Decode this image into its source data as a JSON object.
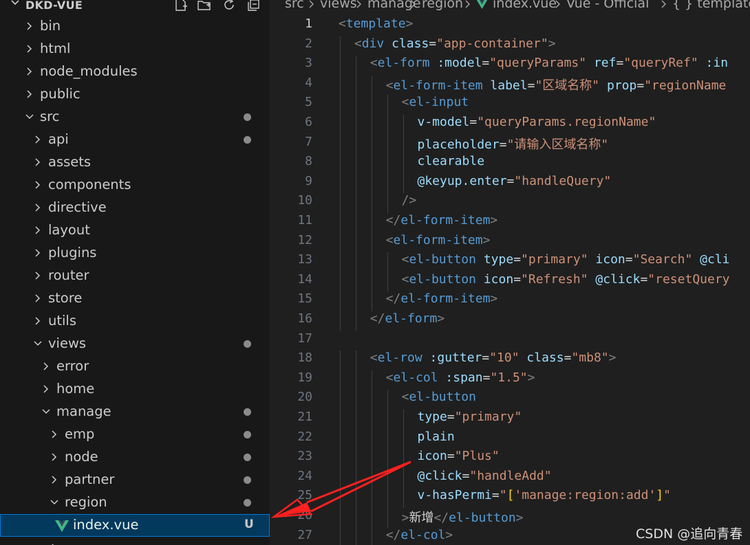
{
  "explorer": {
    "project": "DKD-VUE",
    "tree": [
      {
        "label": "bin",
        "level": 0,
        "expanded": false,
        "dot": false
      },
      {
        "label": "html",
        "level": 0,
        "expanded": false,
        "dot": false
      },
      {
        "label": "node_modules",
        "level": 0,
        "expanded": false,
        "dot": false
      },
      {
        "label": "public",
        "level": 0,
        "expanded": false,
        "dot": false
      },
      {
        "label": "src",
        "level": 0,
        "expanded": true,
        "dot": true
      },
      {
        "label": "api",
        "level": 1,
        "expanded": false,
        "dot": true
      },
      {
        "label": "assets",
        "level": 1,
        "expanded": false,
        "dot": false
      },
      {
        "label": "components",
        "level": 1,
        "expanded": false,
        "dot": false
      },
      {
        "label": "directive",
        "level": 1,
        "expanded": false,
        "dot": false
      },
      {
        "label": "layout",
        "level": 1,
        "expanded": false,
        "dot": false
      },
      {
        "label": "plugins",
        "level": 1,
        "expanded": false,
        "dot": false
      },
      {
        "label": "router",
        "level": 1,
        "expanded": false,
        "dot": false
      },
      {
        "label": "store",
        "level": 1,
        "expanded": false,
        "dot": false
      },
      {
        "label": "utils",
        "level": 1,
        "expanded": false,
        "dot": false
      },
      {
        "label": "views",
        "level": 1,
        "expanded": true,
        "dot": true
      },
      {
        "label": "error",
        "level": 2,
        "expanded": false,
        "dot": false
      },
      {
        "label": "home",
        "level": 2,
        "expanded": false,
        "dot": false
      },
      {
        "label": "manage",
        "level": 2,
        "expanded": true,
        "dot": true
      },
      {
        "label": "emp",
        "level": 3,
        "expanded": false,
        "dot": true
      },
      {
        "label": "node",
        "level": 3,
        "expanded": false,
        "dot": true
      },
      {
        "label": "partner",
        "level": 3,
        "expanded": false,
        "dot": true
      },
      {
        "label": "region",
        "level": 3,
        "expanded": true,
        "dot": true
      },
      {
        "label": "index.vue",
        "level": 4,
        "file": true,
        "badge": "U",
        "selected": true
      }
    ]
  },
  "breadcrumb": [
    "src",
    "views",
    "manage",
    "region",
    "index.vue",
    "Vue - Official",
    "{ } template"
  ],
  "editor": {
    "active_line": 1,
    "lines": [
      {
        "n": "1",
        "indent": 0,
        "tokens": [
          [
            "p",
            "<"
          ],
          [
            "t",
            "template"
          ],
          [
            "p",
            ">"
          ]
        ]
      },
      {
        "n": "2",
        "indent": 1,
        "tokens": [
          [
            "p",
            "<"
          ],
          [
            "t",
            "div"
          ],
          [
            "w",
            " "
          ],
          [
            "a",
            "class"
          ],
          [
            "o",
            "="
          ],
          [
            "s",
            "\"app-container\""
          ],
          [
            "p",
            ">"
          ]
        ]
      },
      {
        "n": "3",
        "indent": 2,
        "tokens": [
          [
            "p",
            "<"
          ],
          [
            "t",
            "el-form"
          ],
          [
            "w",
            " "
          ],
          [
            "a",
            ":model"
          ],
          [
            "o",
            "="
          ],
          [
            "s",
            "\"queryParams\""
          ],
          [
            "w",
            " "
          ],
          [
            "a",
            "ref"
          ],
          [
            "o",
            "="
          ],
          [
            "s",
            "\"queryRef\""
          ],
          [
            "w",
            " "
          ],
          [
            "a",
            ":in"
          ]
        ]
      },
      {
        "n": "4",
        "indent": 3,
        "tokens": [
          [
            "p",
            "<"
          ],
          [
            "t",
            "el-form-item"
          ],
          [
            "w",
            " "
          ],
          [
            "a",
            "label"
          ],
          [
            "o",
            "="
          ],
          [
            "s",
            "\"区域名称\""
          ],
          [
            "w",
            " "
          ],
          [
            "a",
            "prop"
          ],
          [
            "o",
            "="
          ],
          [
            "s",
            "\"regionName"
          ]
        ]
      },
      {
        "n": "5",
        "indent": 4,
        "tokens": [
          [
            "p",
            "<"
          ],
          [
            "t",
            "el-input"
          ]
        ]
      },
      {
        "n": "6",
        "indent": 5,
        "tokens": [
          [
            "a",
            "v-model"
          ],
          [
            "o",
            "="
          ],
          [
            "s",
            "\"queryParams.regionName\""
          ]
        ]
      },
      {
        "n": "7",
        "indent": 5,
        "tokens": [
          [
            "a",
            "placeholder"
          ],
          [
            "o",
            "="
          ],
          [
            "s",
            "\"请输入区域名称\""
          ]
        ]
      },
      {
        "n": "8",
        "indent": 5,
        "tokens": [
          [
            "a",
            "clearable"
          ]
        ]
      },
      {
        "n": "9",
        "indent": 5,
        "tokens": [
          [
            "a",
            "@keyup.enter"
          ],
          [
            "o",
            "="
          ],
          [
            "s",
            "\"handleQuery\""
          ]
        ]
      },
      {
        "n": "10",
        "indent": 4,
        "tokens": [
          [
            "p",
            "/>"
          ]
        ]
      },
      {
        "n": "11",
        "indent": 3,
        "tokens": [
          [
            "p",
            "</"
          ],
          [
            "t",
            "el-form-item"
          ],
          [
            "p",
            ">"
          ]
        ]
      },
      {
        "n": "12",
        "indent": 3,
        "tokens": [
          [
            "p",
            "<"
          ],
          [
            "t",
            "el-form-item"
          ],
          [
            "p",
            ">"
          ]
        ]
      },
      {
        "n": "13",
        "indent": 4,
        "tokens": [
          [
            "p",
            "<"
          ],
          [
            "t",
            "el-button"
          ],
          [
            "w",
            " "
          ],
          [
            "a",
            "type"
          ],
          [
            "o",
            "="
          ],
          [
            "s",
            "\"primary\""
          ],
          [
            "w",
            " "
          ],
          [
            "a",
            "icon"
          ],
          [
            "o",
            "="
          ],
          [
            "s",
            "\"Search\""
          ],
          [
            "w",
            " "
          ],
          [
            "a",
            "@cli"
          ]
        ]
      },
      {
        "n": "14",
        "indent": 4,
        "tokens": [
          [
            "p",
            "<"
          ],
          [
            "t",
            "el-button"
          ],
          [
            "w",
            " "
          ],
          [
            "a",
            "icon"
          ],
          [
            "o",
            "="
          ],
          [
            "s",
            "\"Refresh\""
          ],
          [
            "w",
            " "
          ],
          [
            "a",
            "@click"
          ],
          [
            "o",
            "="
          ],
          [
            "s",
            "\"resetQuery"
          ]
        ]
      },
      {
        "n": "15",
        "indent": 3,
        "tokens": [
          [
            "p",
            "</"
          ],
          [
            "t",
            "el-form-item"
          ],
          [
            "p",
            ">"
          ]
        ]
      },
      {
        "n": "16",
        "indent": 2,
        "tokens": [
          [
            "p",
            "</"
          ],
          [
            "t",
            "el-form"
          ],
          [
            "p",
            ">"
          ]
        ]
      },
      {
        "n": "17",
        "indent": 0,
        "tokens": []
      },
      {
        "n": "18",
        "indent": 2,
        "tokens": [
          [
            "p",
            "<"
          ],
          [
            "t",
            "el-row"
          ],
          [
            "w",
            " "
          ],
          [
            "a",
            ":gutter"
          ],
          [
            "o",
            "="
          ],
          [
            "s",
            "\"10\""
          ],
          [
            "w",
            " "
          ],
          [
            "a",
            "class"
          ],
          [
            "o",
            "="
          ],
          [
            "s",
            "\"mb8\""
          ],
          [
            "p",
            ">"
          ]
        ]
      },
      {
        "n": "19",
        "indent": 3,
        "tokens": [
          [
            "p",
            "<"
          ],
          [
            "t",
            "el-col"
          ],
          [
            "w",
            " "
          ],
          [
            "a",
            ":span"
          ],
          [
            "o",
            "="
          ],
          [
            "s",
            "\"1.5\""
          ],
          [
            "p",
            ">"
          ]
        ]
      },
      {
        "n": "20",
        "indent": 4,
        "tokens": [
          [
            "p",
            "<"
          ],
          [
            "t",
            "el-button"
          ]
        ]
      },
      {
        "n": "21",
        "indent": 5,
        "tokens": [
          [
            "a",
            "type"
          ],
          [
            "o",
            "="
          ],
          [
            "s",
            "\"primary\""
          ]
        ]
      },
      {
        "n": "22",
        "indent": 5,
        "tokens": [
          [
            "a",
            "plain"
          ]
        ]
      },
      {
        "n": "23",
        "indent": 5,
        "tokens": [
          [
            "a",
            "icon"
          ],
          [
            "o",
            "="
          ],
          [
            "s",
            "\"Plus\""
          ]
        ]
      },
      {
        "n": "24",
        "indent": 5,
        "tokens": [
          [
            "a",
            "@click"
          ],
          [
            "o",
            "="
          ],
          [
            "s",
            "\"handleAdd\""
          ]
        ]
      },
      {
        "n": "25",
        "indent": 5,
        "tokens": [
          [
            "a",
            "v-hasPermi"
          ],
          [
            "o",
            "="
          ],
          [
            "s",
            "\""
          ],
          [
            "y",
            "["
          ],
          [
            "s",
            "'manage:region:add'"
          ],
          [
            "y",
            "]"
          ],
          [
            "s",
            "\""
          ]
        ]
      },
      {
        "n": "26",
        "indent": 4,
        "tokens": [
          [
            "p",
            ">"
          ],
          [
            "w",
            "新增"
          ],
          [
            "p",
            "</"
          ],
          [
            "t",
            "el-button"
          ],
          [
            "p",
            ">"
          ]
        ]
      },
      {
        "n": "27",
        "indent": 3,
        "tokens": [
          [
            "p",
            "</"
          ],
          [
            "t",
            "el-col"
          ],
          [
            "p",
            ">"
          ]
        ]
      }
    ]
  },
  "watermark": "CSDN @追向青春"
}
